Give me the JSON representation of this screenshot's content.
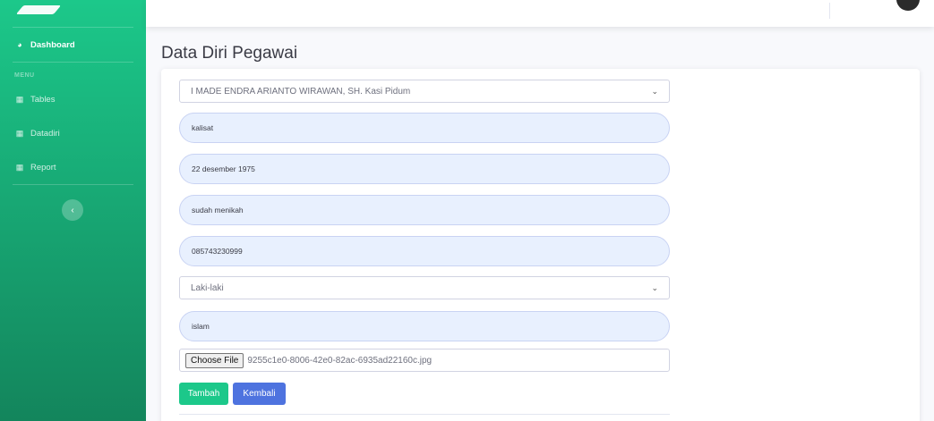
{
  "sidebar": {
    "items": [
      {
        "label": "Dashboard",
        "icon": "tachometer-icon"
      },
      {
        "label": "Tables",
        "icon": "table-icon"
      },
      {
        "label": "Datadiri",
        "icon": "table-icon"
      },
      {
        "label": "Report",
        "icon": "table-icon"
      }
    ],
    "heading": "MENU",
    "toggle_glyph": "‹"
  },
  "page": {
    "title": "Data Diri Pegawai"
  },
  "form": {
    "employee_select": "I MADE ENDRA ARIANTO WIRAWAN, SH. Kasi Pidum",
    "birthplace": "kalisat",
    "birthdate": "22 desember 1975",
    "marital_status": "sudah menikah",
    "phone": "085743230999",
    "gender_select": "Laki-laki",
    "religion": "islam",
    "file_button": "Choose File",
    "file_name": "9255c1e0-8006-42e0-82ac-6935ad22160c.jpg",
    "submit_label": "Tambah",
    "back_label": "Kembali"
  },
  "colors": {
    "sidebar": "#1cc88a",
    "primary": "#4e73df",
    "success": "#1cc88a"
  }
}
